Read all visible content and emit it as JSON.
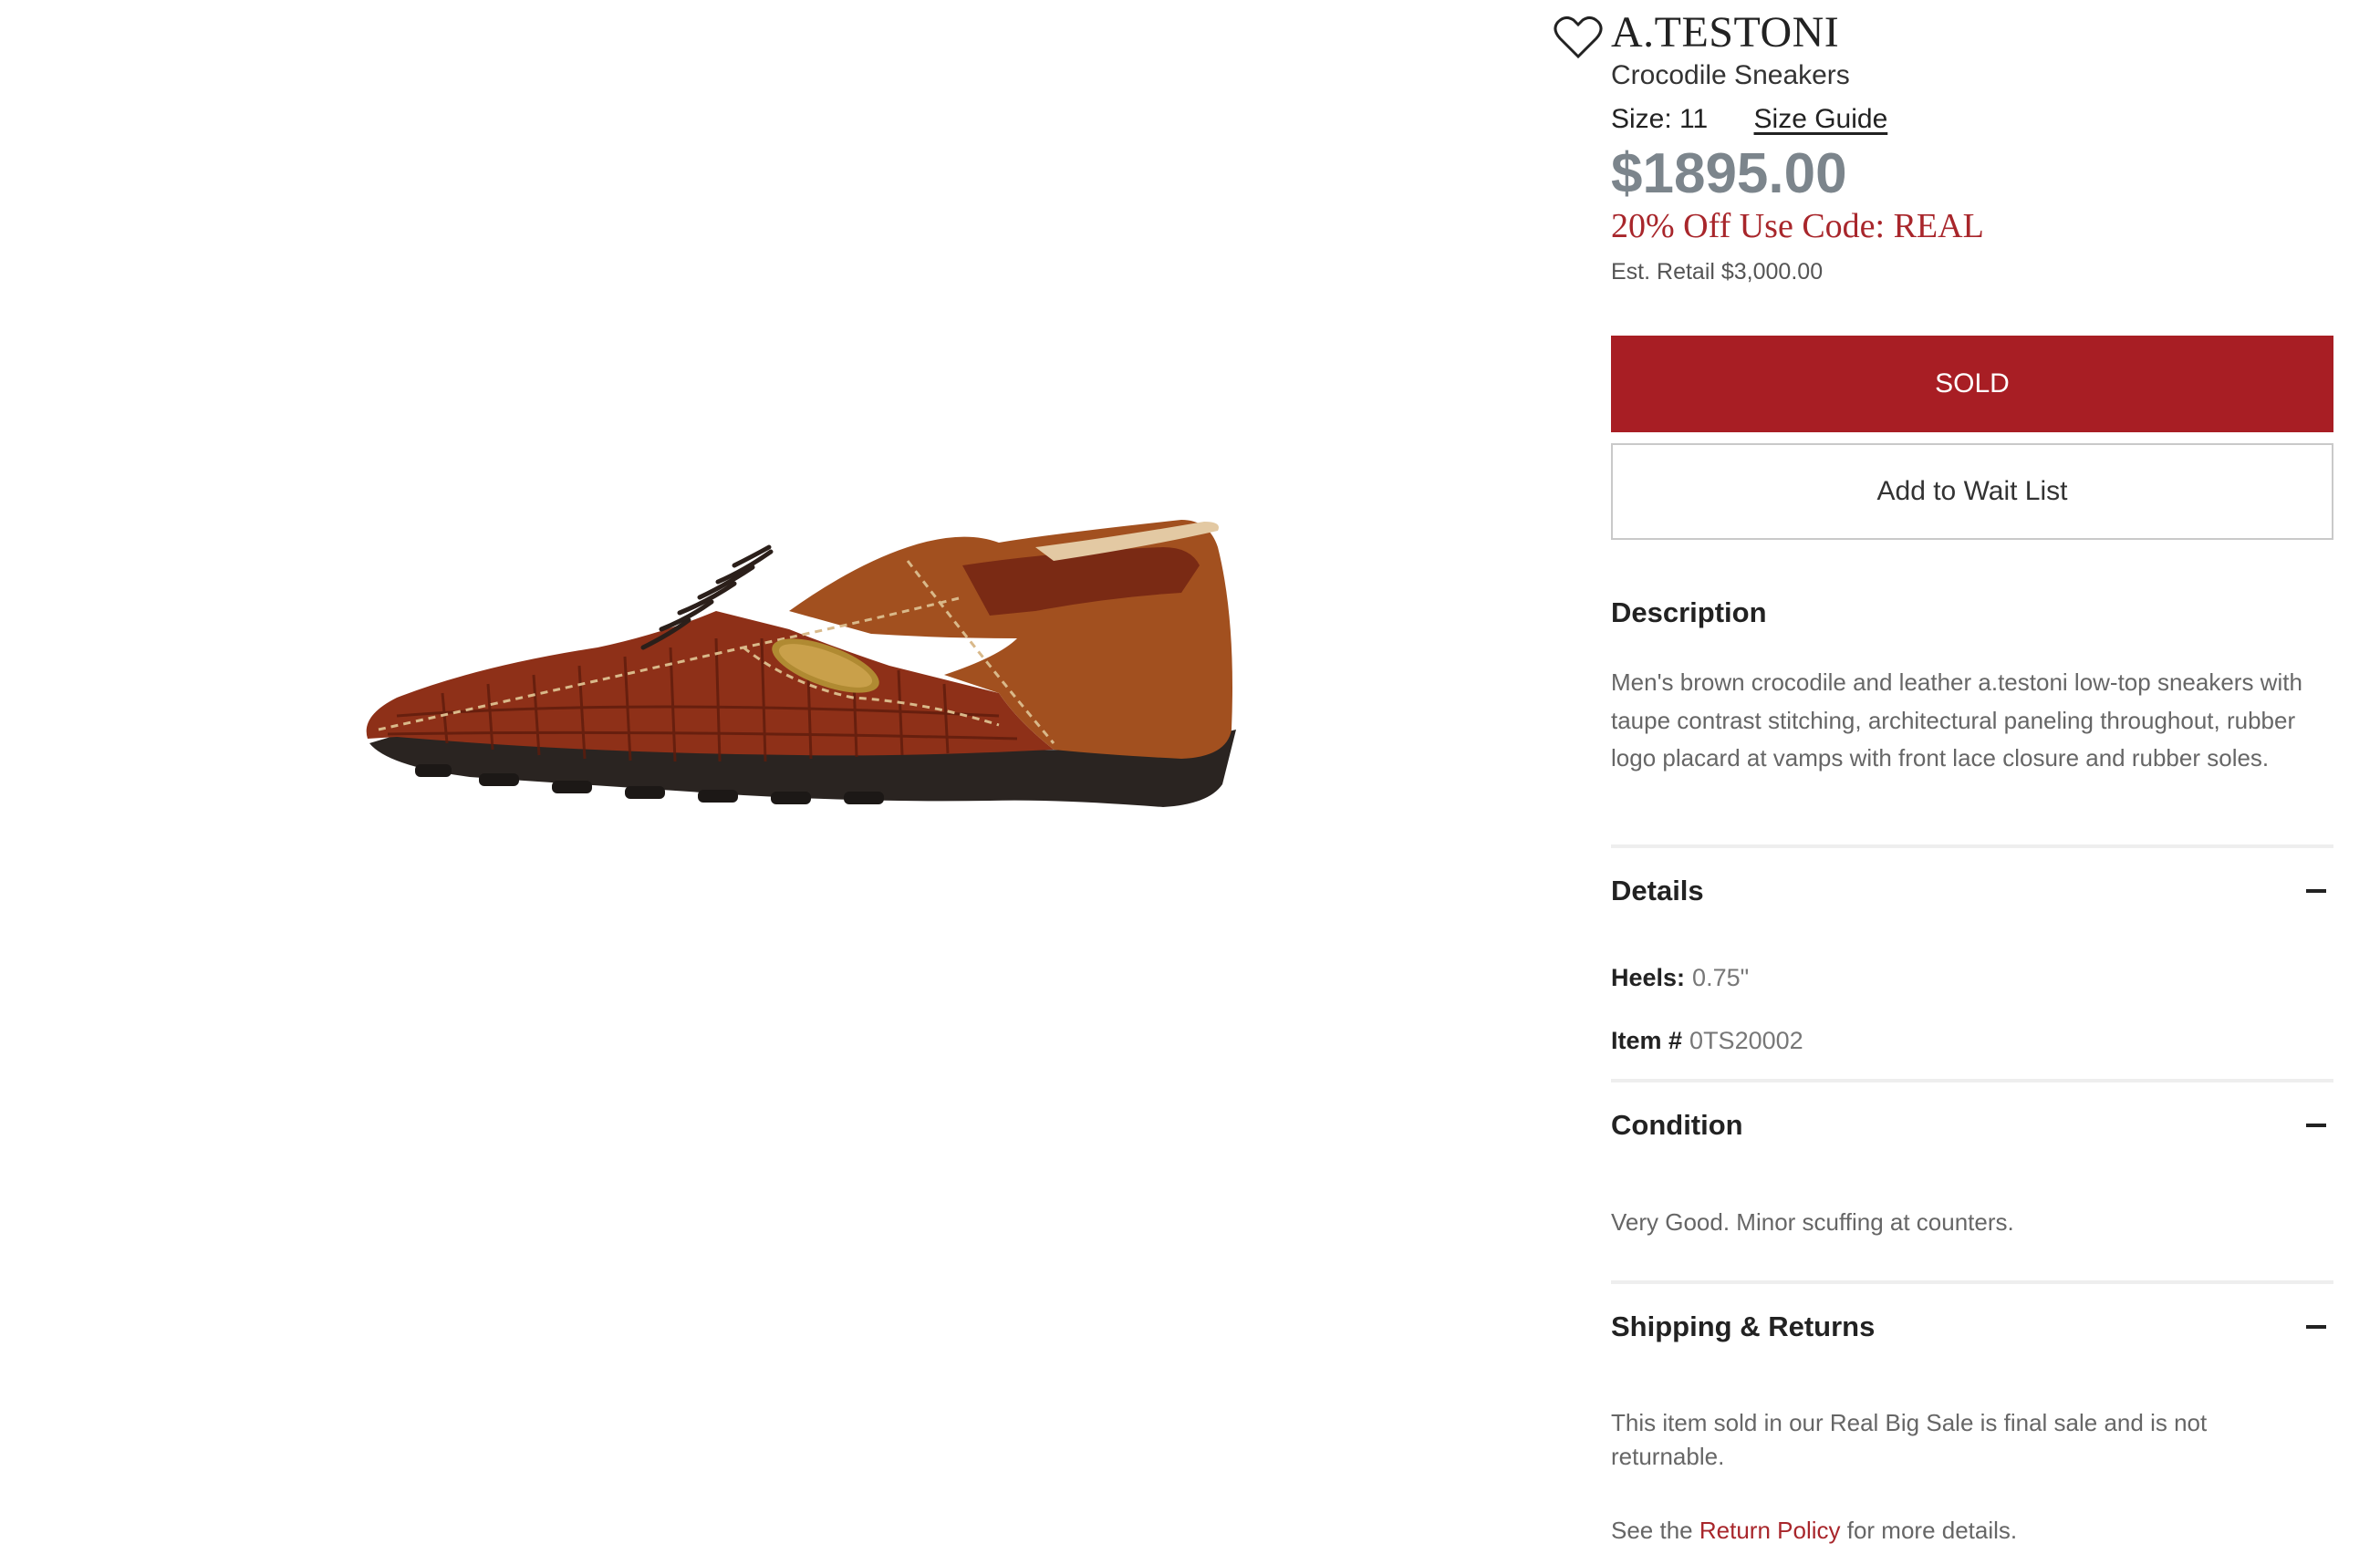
{
  "image": {
    "alt_icon": "shoe-product-image"
  },
  "wishlist": {
    "icon": "heart-icon"
  },
  "product": {
    "brand": "A.TESTONI",
    "name": "Crocodile Sneakers",
    "size_label": "Size: 11",
    "size_guide": "Size Guide",
    "price": "$1895.00",
    "promo": "20% Off Use Code: REAL",
    "retail": "Est. Retail $3,000.00"
  },
  "buttons": {
    "sold": "SOLD",
    "wait_list": "Add to Wait List"
  },
  "description": {
    "title": "Description",
    "text": "Men's brown crocodile and leather a.testoni low-top sneakers with taupe contrast stitching, architectural paneling throughout, rubber logo placard at vamps with front lace closure and rubber soles."
  },
  "details": {
    "title": "Details",
    "heels_key": "Heels:",
    "heels_val": "0.75\"",
    "item_key": "Item #",
    "item_val": "0TS20002"
  },
  "condition": {
    "title": "Condition",
    "text": "Very Good. Minor scuffing at counters."
  },
  "shipping": {
    "title": "Shipping & Returns",
    "text": "This item sold in our Real Big Sale is final sale and is not returnable.",
    "policy_prefix": "See the",
    "policy_link": "Return Policy",
    "policy_suffix": "for more details."
  },
  "colors": {
    "sold_button": "#a81e24",
    "promo_text": "#a8262b",
    "price_text": "#7c858c"
  }
}
